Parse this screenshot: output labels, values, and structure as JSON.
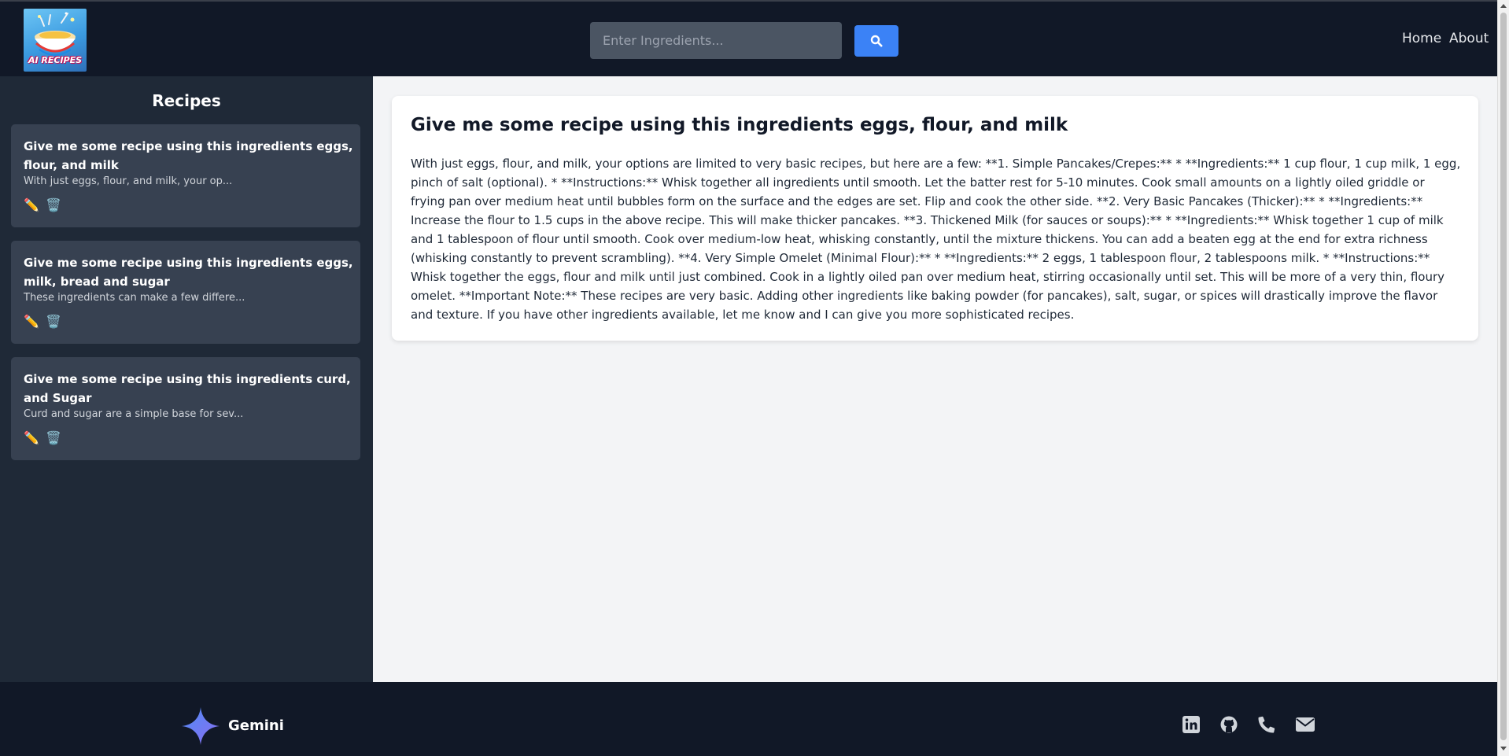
{
  "header": {
    "logo_text": "AI RECIPES",
    "search": {
      "placeholder": "Enter Ingredients...",
      "value": ""
    },
    "search_button_icon": "search-icon",
    "nav": [
      {
        "label": "Home"
      },
      {
        "label": "About"
      }
    ]
  },
  "sidebar": {
    "title": "Recipes",
    "recipes": [
      {
        "title": "Give me some recipe using this ingredients eggs, flour, and milk",
        "preview": "With just eggs, flour, and milk, your op...",
        "edit_icon": "✏️",
        "delete_icon": "🗑️"
      },
      {
        "title": "Give me some recipe using this ingredients eggs, milk, bread and sugar",
        "preview": "These ingredients can make a few differe...",
        "edit_icon": "✏️",
        "delete_icon": "🗑️"
      },
      {
        "title": "Give me some recipe using this ingredients curd, and Sugar",
        "preview": "Curd and sugar are a simple base for sev...",
        "edit_icon": "✏️",
        "delete_icon": "🗑️"
      }
    ]
  },
  "main": {
    "recipe_title": "Give me some recipe using this ingredients eggs, flour, and milk",
    "recipe_body": "With just eggs, flour, and milk, your options are limited to very basic recipes, but here are a few: **1. Simple Pancakes/Crepes:** * **Ingredients:** 1 cup flour, 1 cup milk, 1 egg, pinch of salt (optional). * **Instructions:** Whisk together all ingredients until smooth. Let the batter rest for 5-10 minutes. Cook small amounts on a lightly oiled griddle or frying pan over medium heat until bubbles form on the surface and the edges are set. Flip and cook the other side. **2. Very Basic Pancakes (Thicker):** * **Ingredients:** Increase the flour to 1.5 cups in the above recipe. This will make thicker pancakes. **3. Thickened Milk (for sauces or soups):** * **Ingredients:** Whisk together 1 cup of milk and 1 tablespoon of flour until smooth. Cook over medium-low heat, whisking constantly, until the mixture thickens. You can add a beaten egg at the end for extra richness (whisking constantly to prevent scrambling). **4. Very Simple Omelet (Minimal Flour):** * **Ingredients:** 2 eggs, 1 tablespoon flour, 2 tablespoons milk. * **Instructions:** Whisk together the eggs, flour and milk until just combined. Cook in a lightly oiled pan over medium heat, stirring occasionally until set. This will be more of a very thin, floury omelet. **Important Note:** These recipes are very basic. Adding other ingredients like baking powder (for pancakes), salt, sugar, or spices will drastically improve the flavor and texture. If you have other ingredients available, let me know and I can give you more sophisticated recipes."
  },
  "footer": {
    "brand_label": "Gemini",
    "brand_icon": "gemini-star-icon",
    "social_icons": [
      "linkedin-icon",
      "github-icon",
      "phone-icon",
      "email-icon"
    ]
  },
  "colors": {
    "header_bg": "#111827",
    "sidebar_bg": "#1f2937",
    "card_bg": "#374151",
    "accent": "#3b82f6",
    "main_bg": "#f3f4f6"
  }
}
